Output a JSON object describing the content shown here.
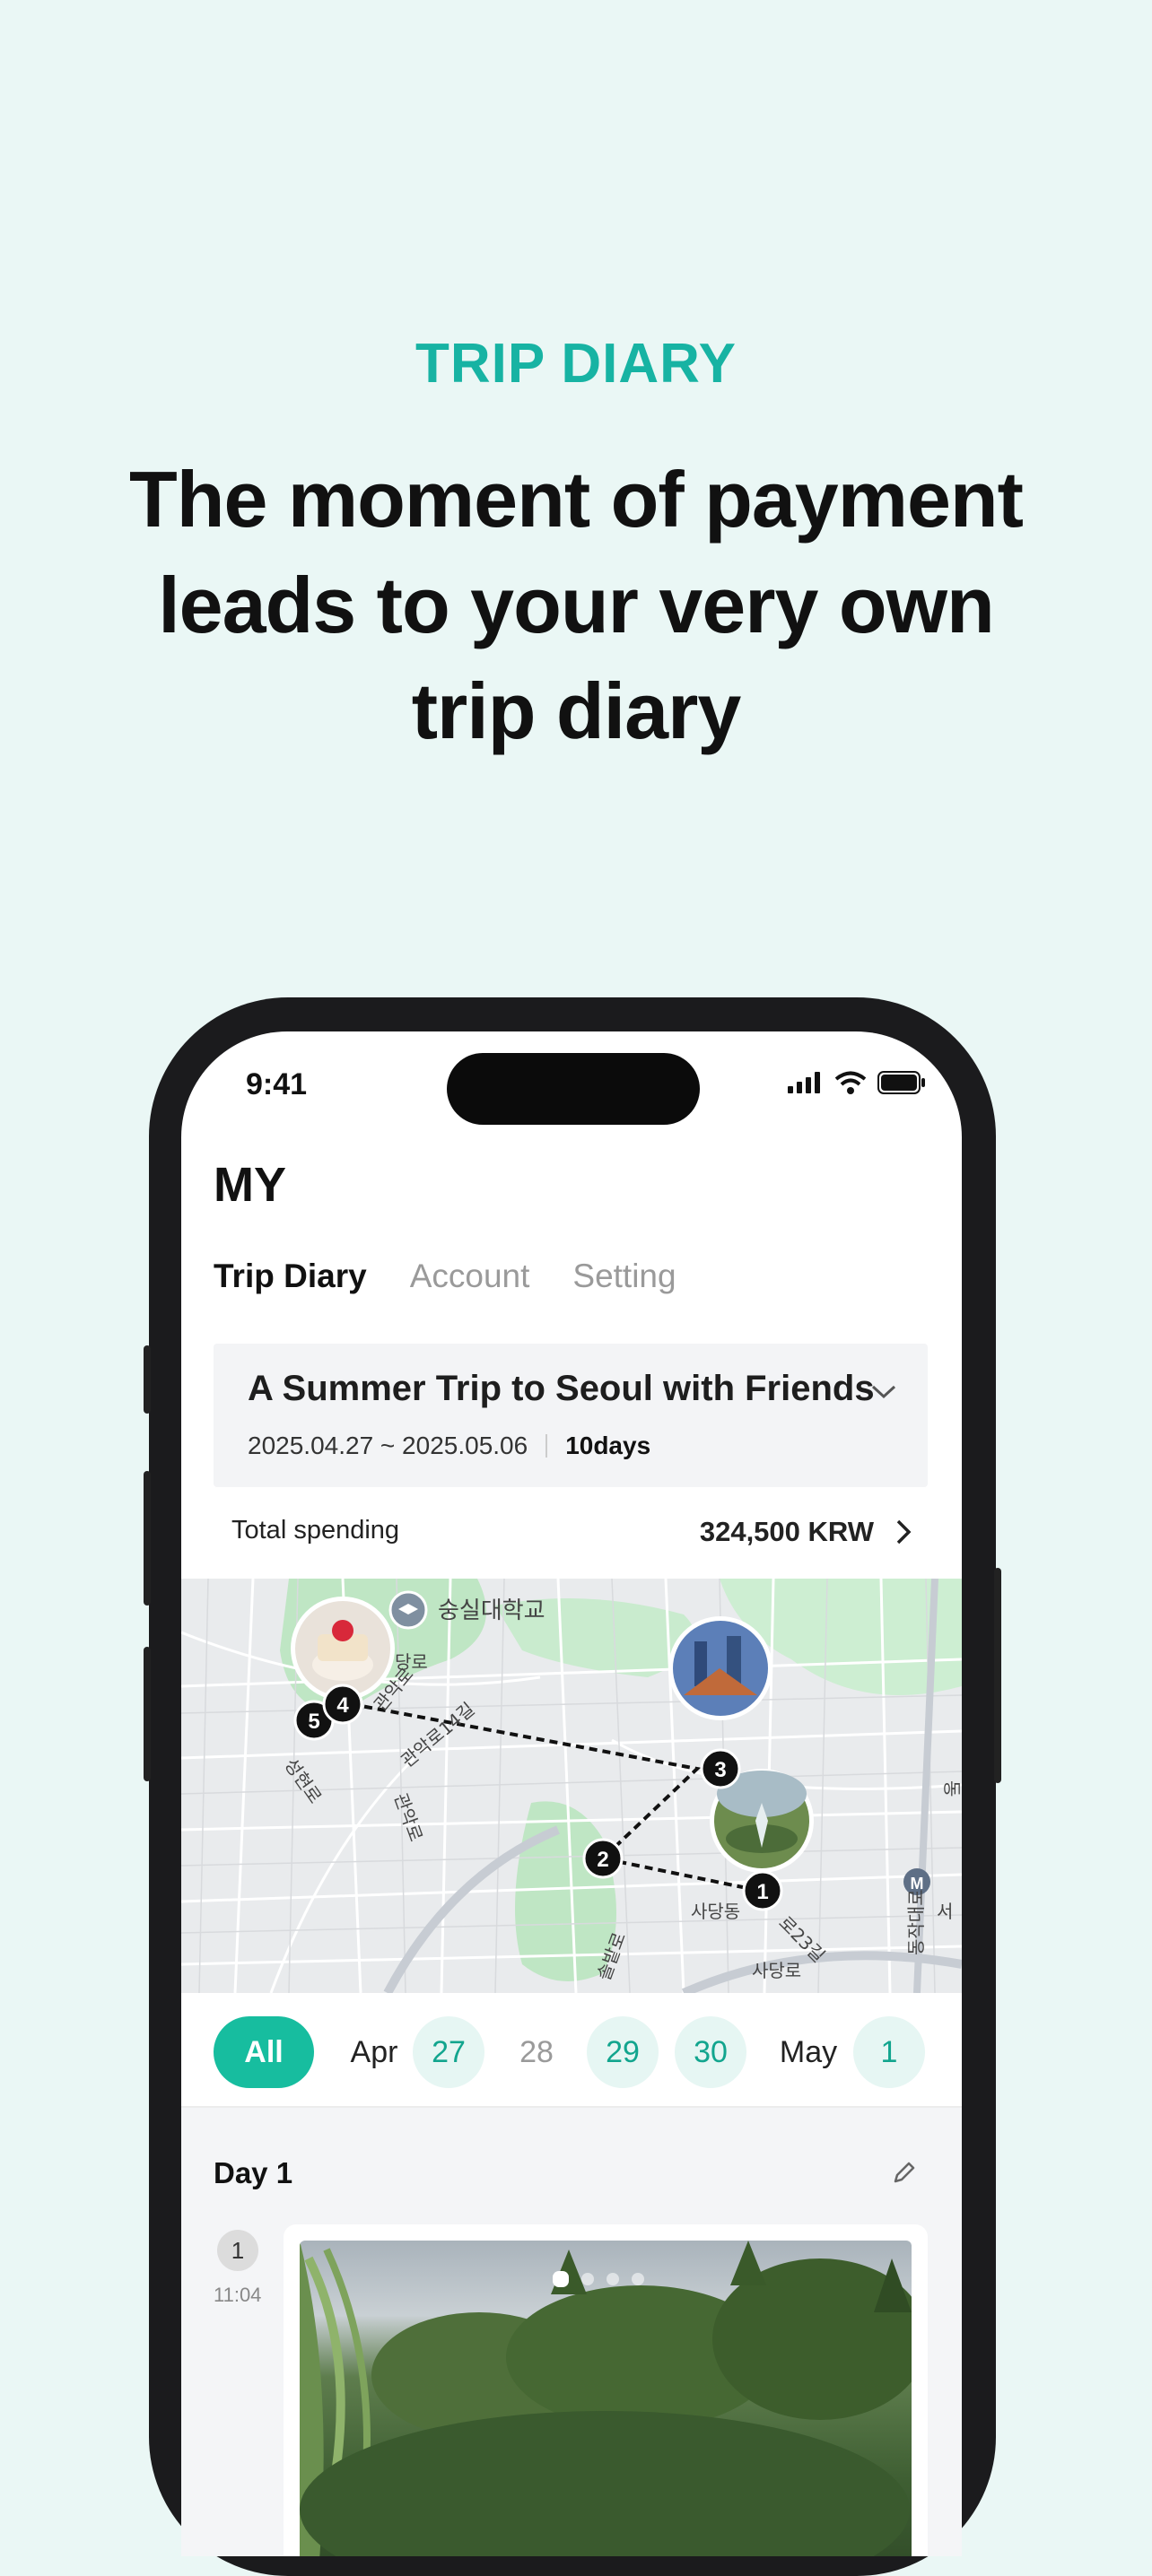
{
  "hero": {
    "eyebrow": "TRIP DIARY",
    "headline_lines": [
      "The moment of payment",
      "leads to your very own",
      "trip diary"
    ]
  },
  "status_bar": {
    "time": "9:41"
  },
  "header": {
    "title": "MY"
  },
  "tabs": [
    {
      "label": "Trip Diary",
      "active": true
    },
    {
      "label": "Account",
      "active": false
    },
    {
      "label": "Setting",
      "active": false
    }
  ],
  "trip": {
    "title": "A Summer Trip to Seoul with Friends",
    "dates": "2025.04.27 ~ 2025.05.06",
    "duration": "10days"
  },
  "spending": {
    "label": "Total spending",
    "amount": "324,500 KRW"
  },
  "map": {
    "labels": [
      "숭실대학교",
      "당로",
      "관악로",
      "성현로",
      "관악로",
      "관악로14길",
      "사당동",
      "로23길",
      "사당로",
      "솔밭로",
      "동작대로",
      "서",
      "동"
    ],
    "markers": [
      "1",
      "2",
      "3",
      "4",
      "5"
    ],
    "metro_icon": "M"
  },
  "date_filter": {
    "all_label": "All",
    "items": [
      {
        "kind": "month",
        "label": "Apr"
      },
      {
        "kind": "date",
        "label": "27",
        "has_entries": true
      },
      {
        "kind": "date",
        "label": "28",
        "has_entries": false
      },
      {
        "kind": "date",
        "label": "29",
        "has_entries": true
      },
      {
        "kind": "date",
        "label": "30",
        "has_entries": true
      },
      {
        "kind": "month",
        "label": "May"
      },
      {
        "kind": "date",
        "label": "1",
        "has_entries": true
      }
    ]
  },
  "day": {
    "title": "Day 1",
    "stop": {
      "number": "1",
      "time": "11:04"
    },
    "photo_count": 4,
    "photo_active_index": 0
  },
  "colors": {
    "accent": "#17b3a3",
    "chip_active": "#17bd9f",
    "chip_bg": "#e6f6f3",
    "background": "#eaf7f5"
  }
}
